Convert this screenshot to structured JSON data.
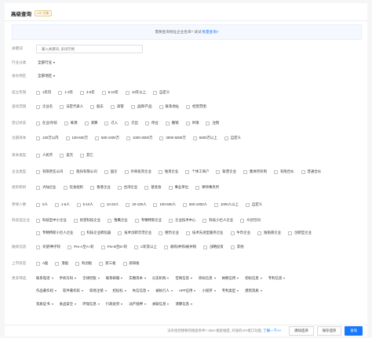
{
  "header": {
    "title": "高级查询",
    "vip": "VIP 功能"
  },
  "banner": {
    "text": "需要查询地址企业名单? 试试",
    "link": "批量查询>"
  },
  "keyword": {
    "label": "关键词",
    "placeholder": "输入关键词, 多词空格"
  },
  "industry": {
    "label": "行业分类",
    "value": "全部行业"
  },
  "region": {
    "label": "省份地区",
    "value": "全部地区"
  },
  "sections": [
    {
      "label": "成立年限",
      "options": [
        "1年内",
        "1-3年",
        "3-5年",
        "5-10年",
        "10年以上",
        "自定义"
      ]
    },
    {
      "label": "查找范围",
      "options": [
        "企业名",
        "法定代表人",
        "股东",
        "高管",
        "品牌/产品",
        "联系地址",
        "经营范围"
      ]
    },
    {
      "label": "登记状态",
      "options": [
        "在业/存续",
        "筹建",
        "清算",
        "迁入",
        "迁出",
        "停业",
        "撤销",
        "吊销",
        "注销"
      ]
    },
    {
      "label": "注册资本",
      "options": [
        "100万以内",
        "100-500万",
        "500-1000万",
        "1000-3000万",
        "3000-5000万",
        "5000万以上",
        "自定义"
      ]
    },
    {
      "label": "资本类型",
      "options": [
        "人民币",
        "美元",
        "其它"
      ]
    },
    {
      "label": "企业类型",
      "options": [
        "有限责任公司",
        "股份有限公司",
        "国企",
        "外商投资企业",
        "独资企业",
        "个体工商户",
        "联营企业",
        "集体所有制",
        "有限合伙",
        "普通合伙"
      ]
    },
    {
      "label": "组织机构",
      "options": [
        "大陆企业",
        "社会组织",
        "香港企业",
        "台湾企业",
        "基金会",
        "事业单位",
        "律师事务所"
      ]
    },
    {
      "label": "参保人数",
      "options": [
        "0人",
        "1-5人",
        "5-10人",
        "10-20人",
        "20-100人",
        "100-500人",
        "500-1000人",
        "1000人以上",
        "自定义"
      ]
    },
    {
      "label": "科技型企业",
      "options": [
        "科技型中小企业",
        "民营科技企业",
        "雏鹰企业",
        "专精特新企业",
        "企业技术中心",
        "科技小巨人企业",
        "众创空间"
      ]
    },
    {
      "label": "",
      "options": [
        "专精特新小巨人企业",
        "科技企业孵化器",
        "技术创新示范企业",
        "瞪羚企业",
        "技术先进型服务企业",
        "牛羚企业",
        "独角兽企业",
        "创新型企业"
      ]
    },
    {
      "label": "融资信息",
      "options": [
        "天使/种子轮",
        "Pre-A至A+轮",
        "Pre-B至B+轮",
        "C轮及以上",
        "收购/并购/被并购",
        "战略投资",
        "其他"
      ]
    },
    {
      "label": "上市状态",
      "options": [
        "A股",
        "港股",
        "科创板",
        "新三板",
        "新四板"
      ]
    }
  ],
  "more_filters": {
    "label": "更多筛选",
    "rows": [
      [
        "联系电话",
        "手机号码",
        "全球控股",
        "联系邮箱",
        "实缴资本",
        "分支机构",
        "官网信息",
        "商标信息",
        "纳税信用",
        "招标信息",
        "专利信息"
      ],
      [
        "作品著作权",
        "软件著作权",
        "简易注销",
        "招投标",
        "失信信息",
        "被执行人",
        "APP应用",
        "小程序",
        "专利类型",
        "建筑资质"
      ],
      [
        "资质证书",
        "食品安全",
        "环保信息",
        "行政处罚",
        "动产抵押",
        "关联信息",
        "清算信息"
      ]
    ]
  },
  "footer": {
    "note": "没有找到想要的搜索条件? 300+搜索维度, 开放的API接口功能, ",
    "link": "了解一下>>",
    "clear": "清除选项",
    "save": "保存选项",
    "search": "查询"
  }
}
